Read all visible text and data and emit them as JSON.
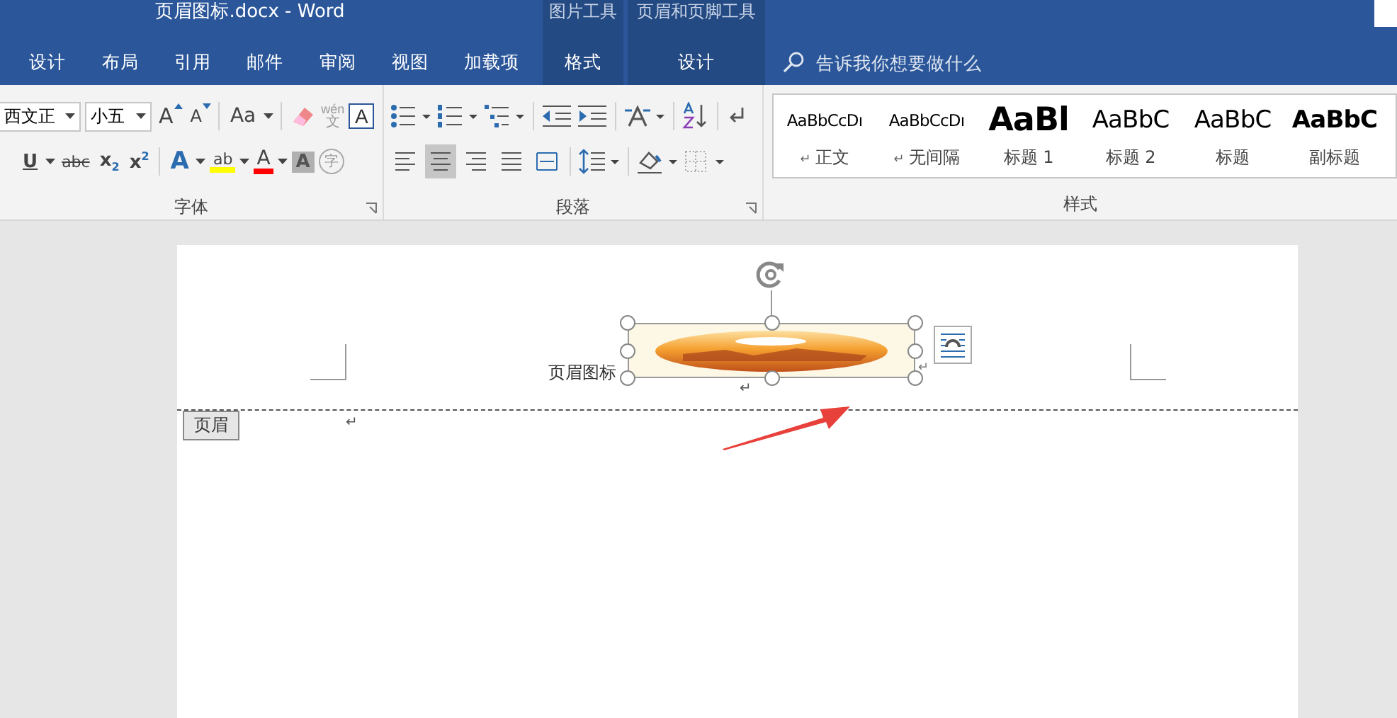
{
  "window": {
    "title": "页眉图标.docx  -  Word"
  },
  "tabs": [
    {
      "label": "设计",
      "selected": false
    },
    {
      "label": "布局",
      "selected": false
    },
    {
      "label": "引用",
      "selected": false
    },
    {
      "label": "邮件",
      "selected": false
    },
    {
      "label": "审阅",
      "selected": false
    },
    {
      "label": "视图",
      "selected": false
    },
    {
      "label": "加载项",
      "selected": false
    }
  ],
  "context_groups": [
    {
      "label": "图片工具",
      "tab": {
        "label": "格式",
        "selected": false
      }
    },
    {
      "label": "页眉和页脚工具",
      "tab": {
        "label": "设计",
        "selected": false
      }
    }
  ],
  "search": {
    "placeholder": "告诉我你想要做什么"
  },
  "font_group": {
    "label": "字体",
    "font_name": "西文正",
    "font_size": "小五",
    "row1_glyphs": [
      "A",
      "A",
      "Aa"
    ],
    "phonetic": [
      "wén",
      "文"
    ],
    "border_char": "A",
    "row2_glyphs": [
      "U",
      "abc",
      "x",
      "2",
      "x",
      "2"
    ],
    "effects": [
      "A",
      "ab",
      "A",
      "A",
      "字"
    ]
  },
  "paragraph_group": {
    "label": "段落",
    "alignments": [
      {
        "selected": false
      },
      {
        "selected": true
      },
      {
        "selected": false
      },
      {
        "selected": false
      },
      {
        "selected": false
      }
    ]
  },
  "styles_group": {
    "label": "样式",
    "items": [
      {
        "kind": "body",
        "preview": "AaBbCcDı",
        "label": "正文",
        "mark": "↵"
      },
      {
        "kind": "body",
        "preview": "AaBbCcDı",
        "label": "无间隔",
        "mark": "↵"
      },
      {
        "kind": "heading1",
        "preview": "AaBl",
        "label": "标题 1"
      },
      {
        "kind": "heading",
        "preview": "AaBbC",
        "label": "标题 2"
      },
      {
        "kind": "heading",
        "preview": "AaBbC",
        "label": "标题"
      },
      {
        "kind": "subtitle",
        "preview": "AaBbC",
        "label": "副标题"
      }
    ]
  },
  "document": {
    "header_text": "页眉图标",
    "image_mark": "↵",
    "anchor_mark": "↵",
    "header_tag": "页眉",
    "body_mark": "↵"
  }
}
